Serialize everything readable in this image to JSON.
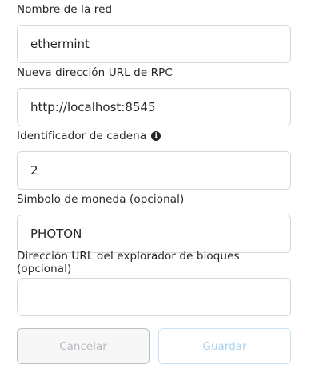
{
  "form": {
    "network_name": {
      "label": "Nombre de la red",
      "value": "ethermint"
    },
    "rpc_url": {
      "label": "Nueva dirección URL de RPC",
      "value": "http://localhost:8545"
    },
    "chain_id": {
      "label": "Identificador de cadena",
      "info_icon": "i",
      "value": "2"
    },
    "currency_symbol": {
      "label": "Símbolo de moneda (opcional)",
      "value": "PHOTON"
    },
    "block_explorer_url": {
      "label": "Dirección URL del explorador de bloques (opcional)",
      "value": ""
    }
  },
  "actions": {
    "cancel_label": "Cancelar",
    "save_label": "Guardar"
  },
  "colors": {
    "text": "#24272a",
    "input_border": "#d2d8dd",
    "disabled_save_text": "#a9d4f0",
    "disabled_cancel_text": "#b8bcc1"
  }
}
